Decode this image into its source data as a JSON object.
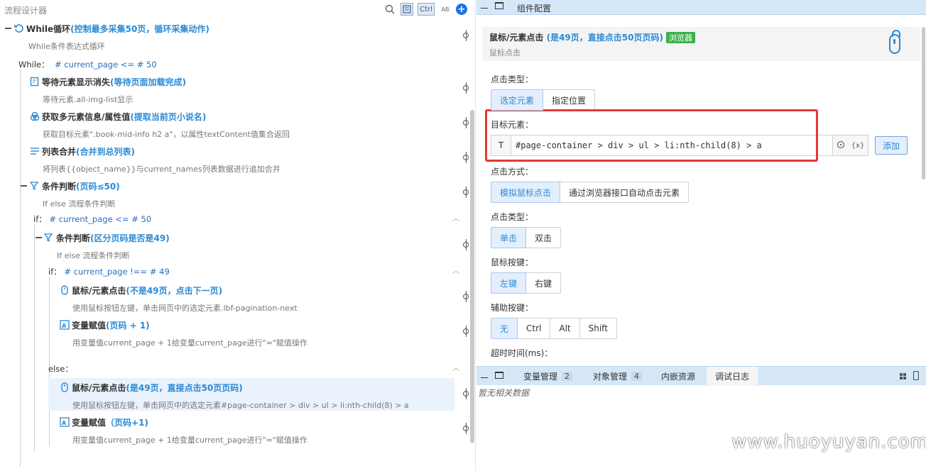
{
  "left": {
    "title": "流程设计器",
    "tools": {
      "ctrl": "Ctrl",
      "ab": "AB"
    },
    "nodes": {
      "while": {
        "title": "While循环",
        "hl": "(控制最多采集50页，循环采集动作)",
        "desc": "While条件表达式循环"
      },
      "while_cond": {
        "label": "While：",
        "expr": "# current_page <= # 50"
      },
      "wait": {
        "title": "等待元素显示消失",
        "hl": "(等待页面加载完成)",
        "desc": "等待元素.all-img-list显示"
      },
      "getattr": {
        "title": "获取多元素信息/属性值",
        "hl": "(提取当前页小说名)",
        "desc": "获取目标元素\".book-mid-info h2 a\"，以属性textContent值集合返回"
      },
      "merge": {
        "title": "列表合并",
        "hl": "(合并到总列表)",
        "desc": "将列表{{object_name}}与current_names列表数据进行追加合并"
      },
      "if1": {
        "title": "条件判断",
        "hl": "(页码≤50)",
        "desc": "If else 流程条件判断"
      },
      "if1_cond": {
        "label": "if：",
        "expr": "# current_page <= # 50"
      },
      "if2": {
        "title": "条件判断",
        "hl": "(区分页码是否是49)",
        "desc": "If else 流程条件判断"
      },
      "if2_cond": {
        "label": "if：",
        "expr": "# current_page !== # 49"
      },
      "click1": {
        "title": "鼠标/元素点击",
        "hl": "(不是49页，点击下一页)",
        "desc": "使用鼠标按钮左键，单击网页中的选定元素.lbf-pagination-next"
      },
      "assign1": {
        "title": "变量赋值",
        "hl": "(页码 + 1)",
        "desc": "用变量值current_page + 1给变量current_page进行\"=\"赋值操作"
      },
      "else": {
        "label": "else："
      },
      "click2": {
        "title": "鼠标/元素点击",
        "hl": "(是49页，直接点击50页页码)",
        "desc": "使用鼠标按钮左键，单击网页中的选定元素#page-container > div > ul > li:nth-child(8) > a"
      },
      "assign2": {
        "title": "变量赋值",
        "hl": "（页码+1)",
        "desc": "用变量值current_page + 1给变量current_page进行\"=\"赋值操作"
      }
    }
  },
  "right": {
    "bar_title": "组件配置",
    "card": {
      "title": "鼠标/元素点击",
      "hl": "(是49页，直接点击50页页码)",
      "badge": "浏览器",
      "sub": "鼠标点击"
    },
    "click_type": {
      "label": "点击类型：",
      "opts": [
        "选定元素",
        "指定位置"
      ]
    },
    "target": {
      "label": "目标元素：",
      "prefix": "T",
      "value": "#page-container > div > ul > li:nth-child(8) > a",
      "var": "{x}",
      "add": "添加"
    },
    "click_method": {
      "label": "点击方式：",
      "opts": [
        "模拟鼠标点击",
        "通过浏览器接口自动点击元素"
      ]
    },
    "click_kind": {
      "label": "点击类型：",
      "opts": [
        "单击",
        "双击"
      ]
    },
    "mouse_key": {
      "label": "鼠标按键：",
      "opts": [
        "左键",
        "右键"
      ]
    },
    "aux_key": {
      "label": "辅助按键：",
      "opts": [
        "无",
        "Ctrl",
        "Alt",
        "Shift"
      ]
    },
    "timeout": {
      "label": "超时时间(ms)："
    },
    "bottom_tabs": [
      {
        "label": "变量管理",
        "count": "2"
      },
      {
        "label": "对象管理",
        "count": "4"
      },
      {
        "label": "内嵌资源",
        "count": ""
      },
      {
        "label": "调试日志",
        "count": ""
      }
    ],
    "no_data": "暂无相关数据"
  },
  "watermark": "www.huoyuyan.com"
}
